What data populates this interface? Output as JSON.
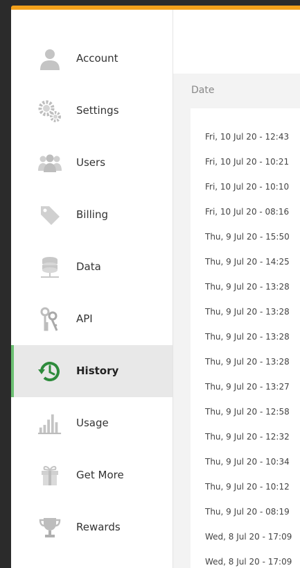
{
  "accent_color": "#f4a11b",
  "active_color": "#6cc072",
  "sidebar": {
    "items": [
      {
        "label": "Account",
        "icon": "user-icon",
        "active": false
      },
      {
        "label": "Settings",
        "icon": "gear-icon",
        "active": false
      },
      {
        "label": "Users",
        "icon": "users-icon",
        "active": false
      },
      {
        "label": "Billing",
        "icon": "tag-icon",
        "active": false
      },
      {
        "label": "Data",
        "icon": "database-icon",
        "active": false
      },
      {
        "label": "API",
        "icon": "keys-icon",
        "active": false
      },
      {
        "label": "History",
        "icon": "history-icon",
        "active": true
      },
      {
        "label": "Usage",
        "icon": "bar-chart-icon",
        "active": false
      },
      {
        "label": "Get More",
        "icon": "gift-icon",
        "active": false
      },
      {
        "label": "Rewards",
        "icon": "trophy-icon",
        "active": false
      }
    ]
  },
  "history": {
    "column_header": "Date",
    "rows": [
      "Fri, 10 Jul 20 - 12:43",
      "Fri, 10 Jul 20 - 10:21",
      "Fri, 10 Jul 20 - 10:10",
      "Fri, 10 Jul 20 - 08:16",
      "Thu, 9 Jul 20 - 15:50",
      "Thu, 9 Jul 20 - 14:25",
      "Thu, 9 Jul 20 - 13:28",
      "Thu, 9 Jul 20 - 13:28",
      "Thu, 9 Jul 20 - 13:28",
      "Thu, 9 Jul 20 - 13:28",
      "Thu, 9 Jul 20 - 13:27",
      "Thu, 9 Jul 20 - 12:58",
      "Thu, 9 Jul 20 - 12:32",
      "Thu, 9 Jul 20 - 10:34",
      "Thu, 9 Jul 20 - 10:12",
      "Thu, 9 Jul 20 - 08:19",
      "Wed, 8 Jul 20 - 17:09",
      "Wed, 8 Jul 20 - 17:09"
    ]
  }
}
